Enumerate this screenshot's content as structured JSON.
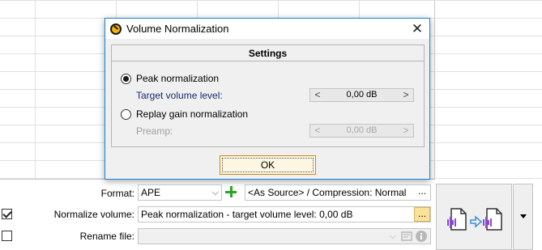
{
  "dialog": {
    "title": "Volume Normalization",
    "close_glyph": "✕",
    "group_title": "Settings",
    "peak": {
      "label": "Peak normalization",
      "checked": true,
      "target_label": "Target volume level:",
      "target_value": "0,00 dB"
    },
    "replay": {
      "label": "Replay gain normalization",
      "checked": false,
      "preamp_label": "Preamp:",
      "preamp_value": "0,00 dB"
    },
    "ok_label": "OK",
    "left_arrow": "<",
    "right_arrow": ">"
  },
  "options": {
    "format_label": "Format:",
    "format_value": "APE",
    "format_settings": "<As Source> / Compression: Normal",
    "normalize_label": "Normalize volume:",
    "normalize_checked": true,
    "normalize_value": "Peak normalization - target volume level: 0,00 dB",
    "rename_label": "Rename file:",
    "rename_checked": false,
    "rename_value": "",
    "dots": "..."
  },
  "icons": {
    "app": "app-logo-icon",
    "add": "plus-icon",
    "convert": "audio-convert-icon",
    "info": "info-icon"
  }
}
